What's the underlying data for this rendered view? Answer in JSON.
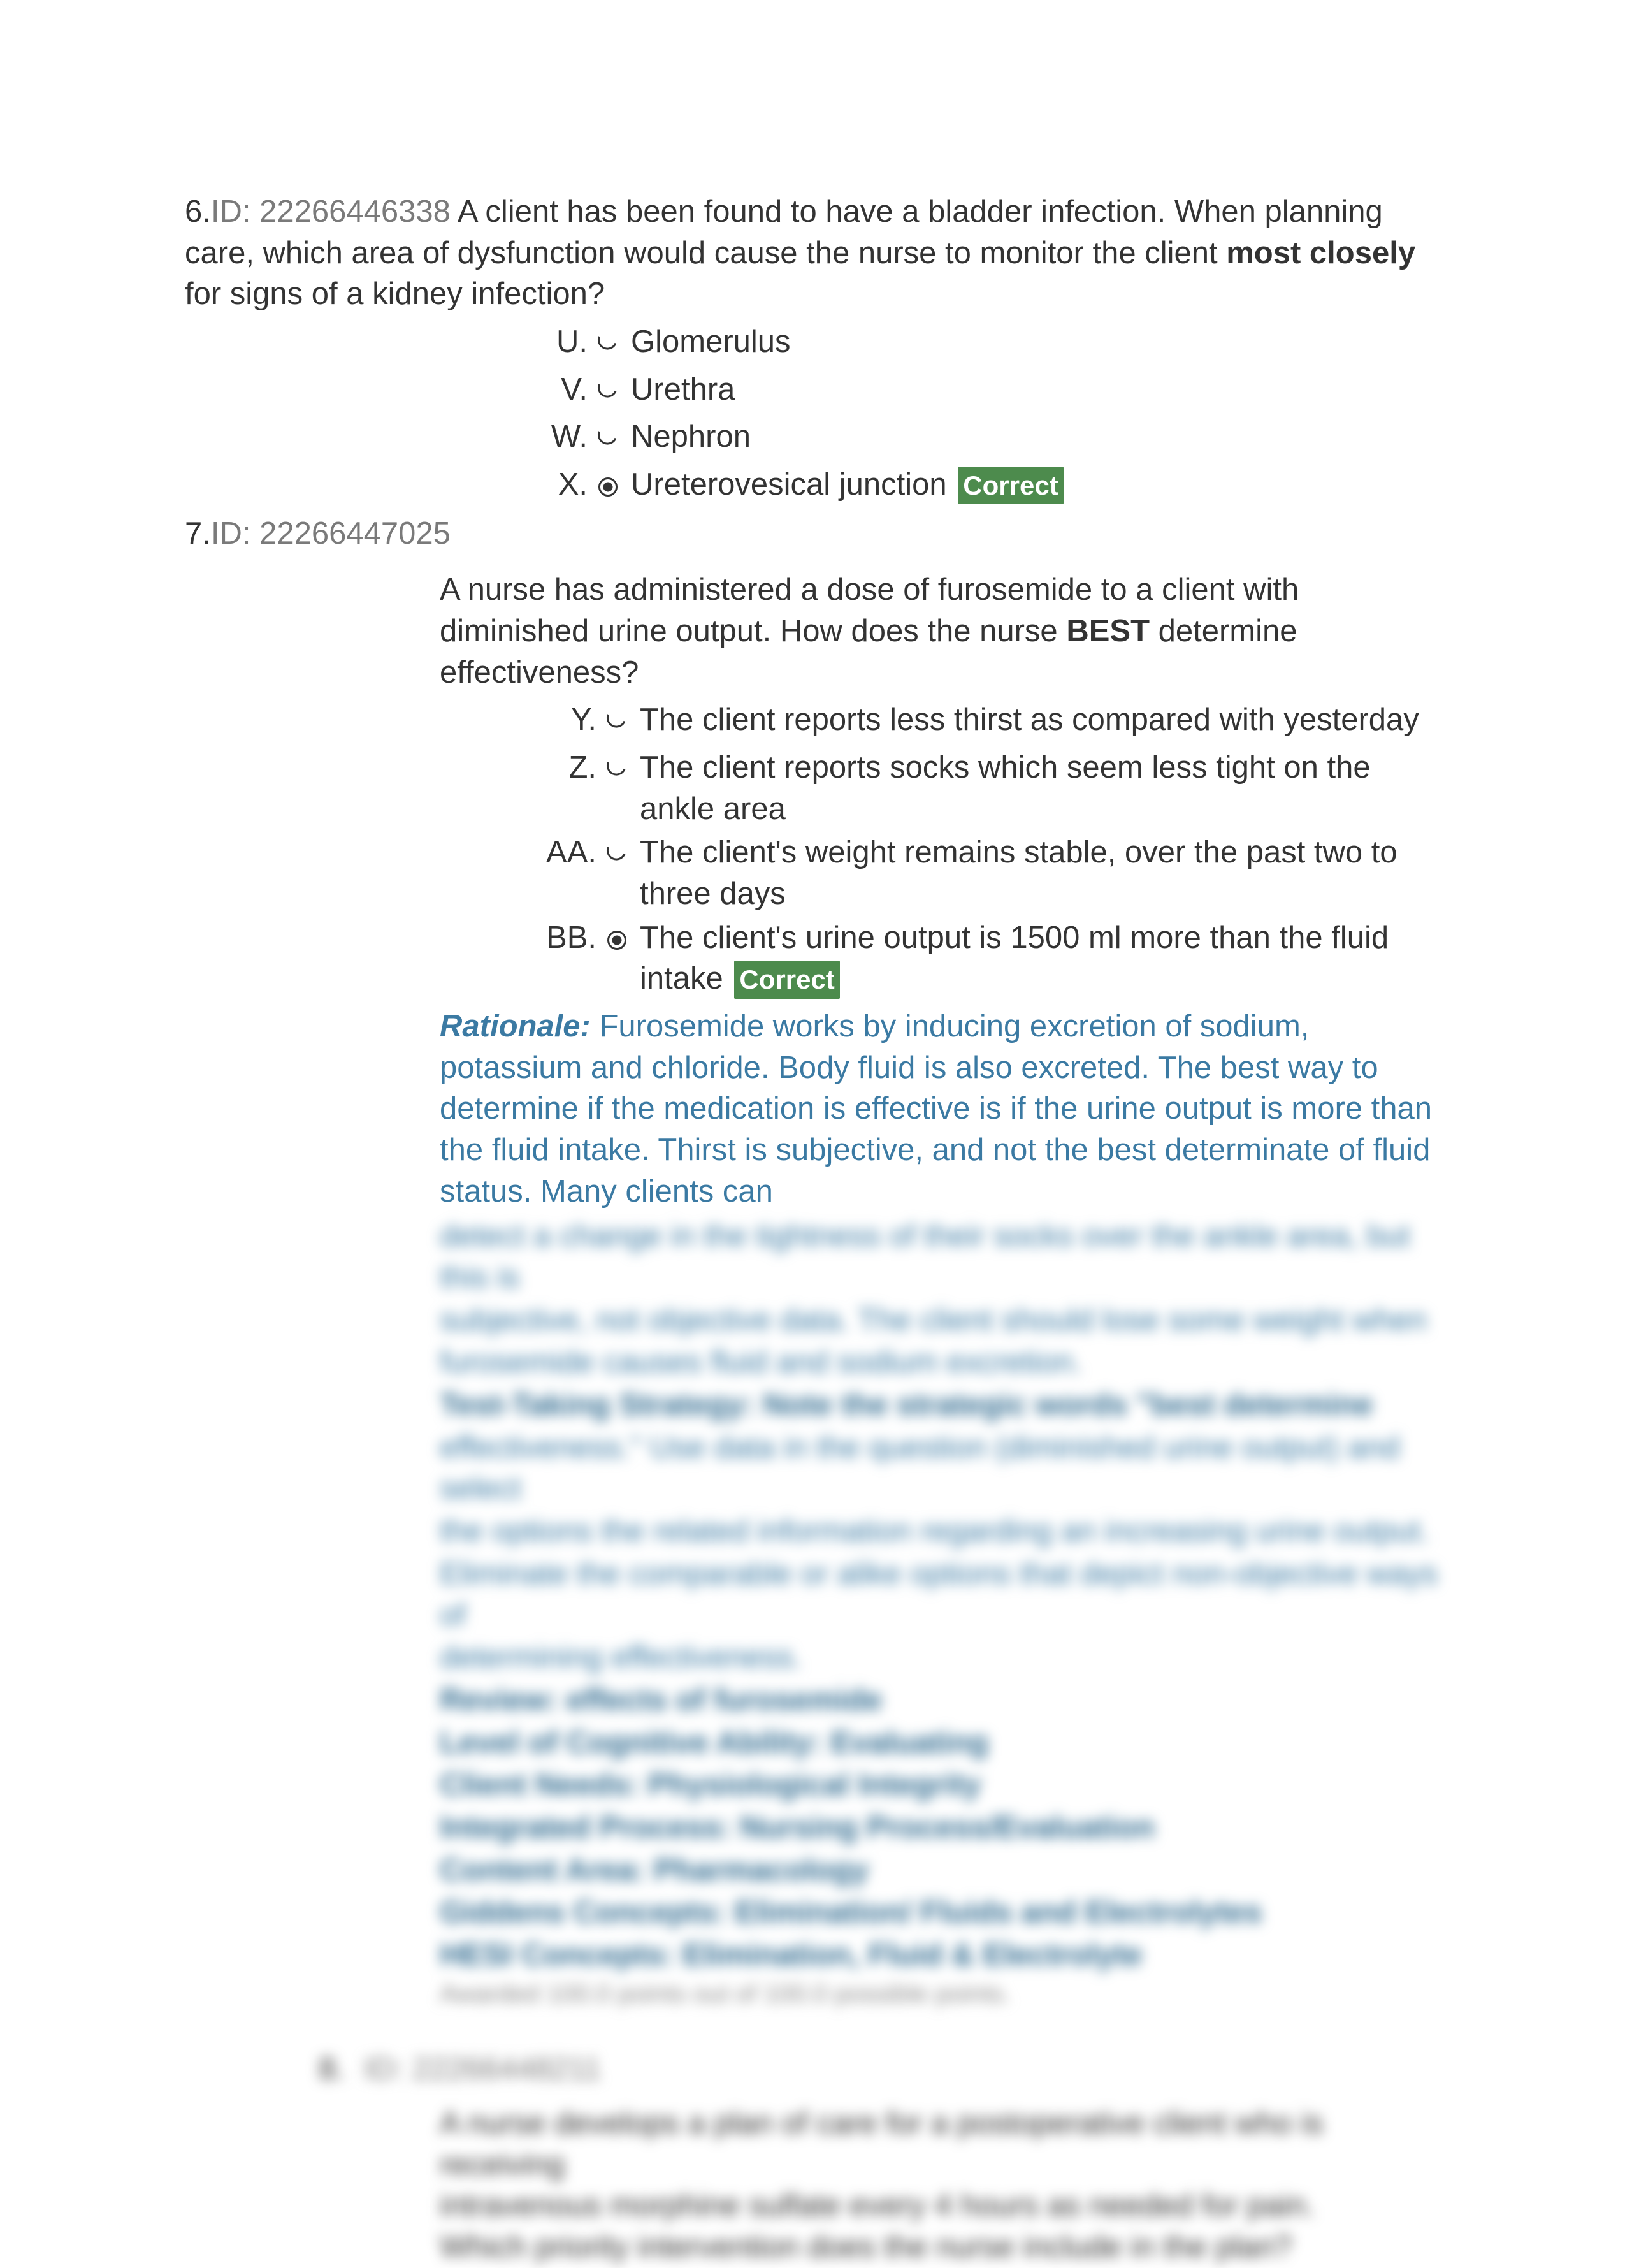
{
  "q6": {
    "number": "6.",
    "id_label": "ID:",
    "id_value": "22266446338",
    "stem_part1": "A client has been found to have a bladder infection. When planning care, which area of dysfunction would cause the nurse to monitor the client ",
    "stem_bold": "most closely",
    "stem_part2": " for signs of a kidney infection?",
    "options": [
      {
        "letter": "U.",
        "text": "Glomerulus",
        "selected": false
      },
      {
        "letter": "V.",
        "text": "Urethra",
        "selected": false
      },
      {
        "letter": "W.",
        "text": "Nephron",
        "selected": false
      },
      {
        "letter": "X.",
        "text": "Ureterovesical junction",
        "selected": true,
        "badge": "Correct"
      }
    ]
  },
  "q7": {
    "number": "7.",
    "id_label": "ID:",
    "id_value": "22266447025",
    "stem_part1": "A nurse has administered a dose of furosemide to a client with diminished urine output. How does the nurse ",
    "stem_bold": "BEST",
    "stem_part2": " determine effectiveness?",
    "options": [
      {
        "letter": "Y.",
        "text": "The client reports less thirst as compared with yesterday",
        "selected": false
      },
      {
        "letter": "Z.",
        "text": "The client reports socks which seem less tight on the ankle area",
        "selected": false
      },
      {
        "letter": "AA.",
        "text": "The client's weight remains stable, over the past two to three days",
        "selected": false
      },
      {
        "letter": "BB.",
        "text": "The client's urine output is 1500 ml more than the fluid intake",
        "selected": true,
        "badge": "Correct"
      }
    ],
    "rationale_label": "Rationale:",
    "rationale_text": " Furosemide works by inducing excretion of sodium, potassium and chloride. Body fluid is also excreted. The best way to determine if the medication is effective is if the urine output is more than the fluid intake. Thirst is subjective, and not the best determinate of fluid status. Many clients can "
  },
  "blur": {
    "lines": [
      "detect a change in the tightness of their socks over the ankle area, but this is",
      "subjective, not objective data. The client should lose some weight when",
      "furosemide causes fluid and sodium excretion.",
      "Test-Taking Strategy: Note the strategic words \"best determine",
      "effectiveness.\" Use data in the question (diminished urine output) and select",
      "the options the related information regarding an increasing urine output.",
      "Eliminate the comparable or alike options that depict non-objective ways of",
      "determining effectiveness.",
      "Review: effects of furosemide",
      "Level of Cognitive Ability: Evaluating",
      "Client Needs: Physiological Integrity",
      "Integrated Process: Nursing Process/Evaluation",
      "Content Area: Pharmacology",
      "Giddens Concepts: Elimination/ Fluids and Electrolytes",
      "HESI Concepts: Elimination, Fluid & Electrolyte"
    ],
    "award_line": "Awarded 100.0 points out of 100.0 possible points."
  },
  "q8": {
    "number": "8.",
    "id_label": "ID:",
    "id_value": "22266448211",
    "stem_lines": [
      "A nurse develops a plan of care for a postoperative client who is receiving",
      "intravenous morphine sulfate every 4 hours as needed for pain.",
      "Which priority intervention does the nurse include in the plan?"
    ]
  }
}
